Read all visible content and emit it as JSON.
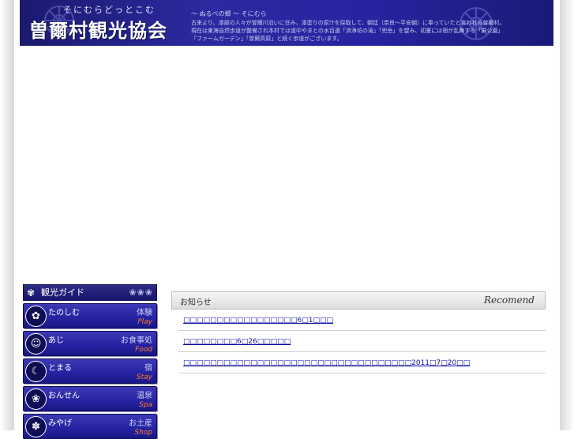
{
  "header": {
    "kana_title": "そにむらどっとこむ",
    "logo": "曽爾村観光協会",
    "subtitle": "〜 ぬるべの郷 〜 そにむら",
    "description_lines": [
      "古来より、漆部の人々が曽爾川沿いに住み、漆塗りの原汁を採取して、朝廷（奈良〜平安朝）に奉っていたと言われる曽爾村。",
      "現在は東海自然歩道が整備され本村では道中やまとの水百選「済浄坊の滝」「兜岳」を望み、初夏には宿が乱舞する「屏公園」",
      "「ファームガーデン」「曽爾高原」と続く歩道がございます。"
    ]
  },
  "sidebar": {
    "heading": "観光ガイド",
    "heading_deco": "❀❀❀",
    "items": [
      {
        "label": "たのしむ",
        "kanji": "体験",
        "en": "Play",
        "icon": "flower-crest-icon"
      },
      {
        "label": "あじ",
        "kanji": "お食事処",
        "en": "Food",
        "icon": "face-crest-icon"
      },
      {
        "label": "とまる",
        "kanji": "宿",
        "en": "Stay",
        "icon": "moon-crest-icon"
      },
      {
        "label": "おんせん",
        "kanji": "温泉",
        "en": "Spa",
        "icon": "spa-crest-icon"
      },
      {
        "label": "みやげ",
        "kanji": "お土産",
        "en": "Shop",
        "icon": "gift-crest-icon"
      }
    ]
  },
  "news": {
    "heading": "お知らせ",
    "heading_right": "Recomend",
    "items": [
      "□□□□□□□□□□□□□□□□□6□1□□□",
      "□□□□□□□□6□26□□□□□",
      "□□□□□□□□□□□□□□□□□□□□□□□□□□□□□□□□□□2011□7□20□□"
    ]
  }
}
